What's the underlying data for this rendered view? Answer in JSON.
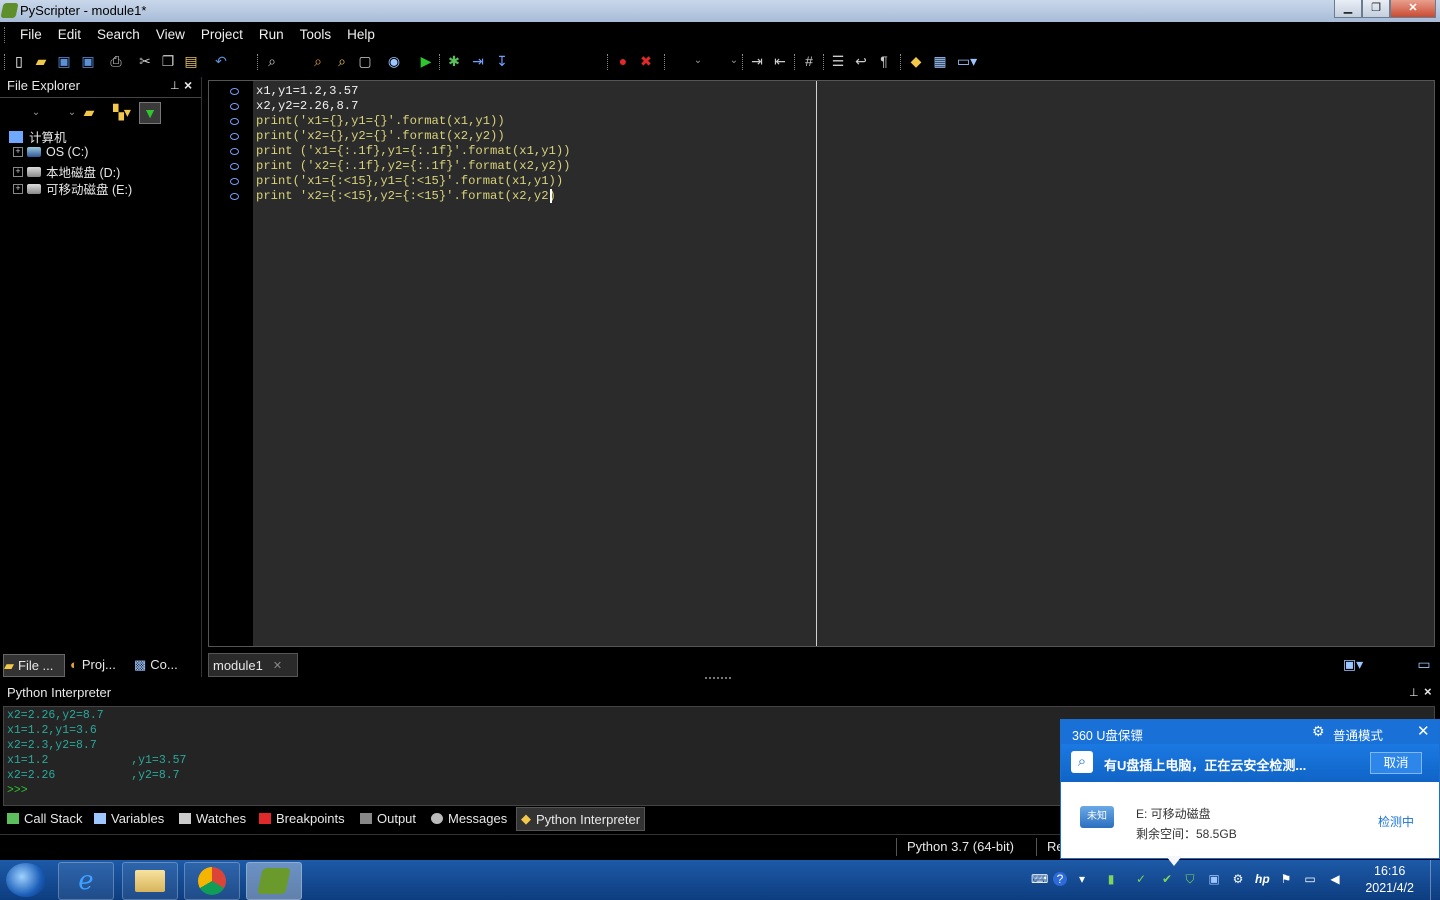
{
  "window": {
    "title": "PyScripter - module1*"
  },
  "menu": [
    "File",
    "Edit",
    "Search",
    "View",
    "Project",
    "Run",
    "Tools",
    "Help"
  ],
  "explorer": {
    "title": "File Explorer",
    "root": "计算机",
    "items": [
      "OS (C:)",
      "本地磁盘 (D:)",
      "可移动磁盘 (E:)"
    ]
  },
  "panel_tabs": [
    "File ...",
    "Proj...",
    "Co..."
  ],
  "editor": {
    "tab": "module1",
    "lines": [
      "x1,y1=1.2,3.57",
      "x2,y2=2.26,8.7",
      "print('x1={},y1={}'.format(x1,y1))",
      "print('x2={},y2={}'.format(x2,y2))",
      "print ('x1={:.1f},y1={:.1f}'.format(x1,y1))",
      "print ('x2={:.1f},y2={:.1f}'.format(x2,y2))",
      "print('x1={:<15},y1={:<15}'.format(x1,y1))",
      "print 'x2={:<15},y2={:<15}'.format(x2,y2)"
    ]
  },
  "interpreter": {
    "title": "Python Interpreter",
    "lines": [
      "x2=2.26,y2=8.7",
      "x1=1.2,y1=3.6",
      "x2=2.3,y2=8.7",
      "x1=1.2            ,y1=3.57",
      "x2=2.26           ,y2=8.7",
      ">>>"
    ]
  },
  "bottom_tabs": [
    "Call Stack",
    "Variables",
    "Watches",
    "Breakpoints",
    "Output",
    "Messages",
    "Python Interpreter"
  ],
  "status": {
    "python_version": "Python 3.7 (64-bit)",
    "partial": "Re"
  },
  "popup": {
    "title": "360 U盘保镖",
    "mode": "普通模式",
    "message": "有U盘插上电脑，正在云安全检测...",
    "cancel": "取消",
    "drive_name": "E: 可移动磁盘",
    "free_space": "剩余空间：58.5GB",
    "status": "检测中",
    "icon_text": "未知"
  },
  "clock": {
    "time": "16:16",
    "date": "2021/4/2"
  }
}
